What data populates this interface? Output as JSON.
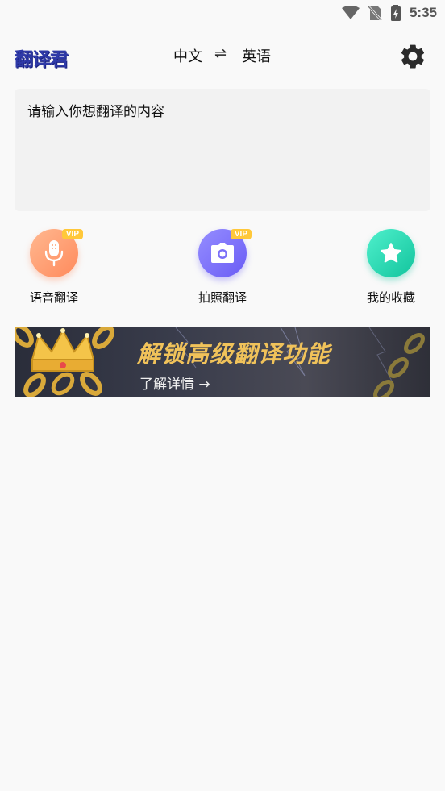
{
  "status_bar": {
    "time": "5:35"
  },
  "app_bar": {
    "logo": "翻译君",
    "source_lang": "中文",
    "swap_symbol": "⇌",
    "target_lang": "英语"
  },
  "input": {
    "placeholder": "请输入你想翻译的内容"
  },
  "features": [
    {
      "label": "语音翻译",
      "badge": "VIP"
    },
    {
      "label": "拍照翻译",
      "badge": "VIP"
    },
    {
      "label": "我的收藏"
    }
  ],
  "banner": {
    "title": "解锁高级翻译功能",
    "subtitle": "了解详情 →"
  },
  "colors": {
    "logo": "#2f3aa8",
    "voice_gradient": [
      "#ffb08a",
      "#ff8a5c"
    ],
    "camera_gradient": [
      "#8f86ff",
      "#6a5cf5"
    ],
    "favorite_gradient": [
      "#3ee6c2",
      "#14c7a0"
    ],
    "vip_badge": "#ffc83a",
    "banner_title": "#f0c25a"
  }
}
